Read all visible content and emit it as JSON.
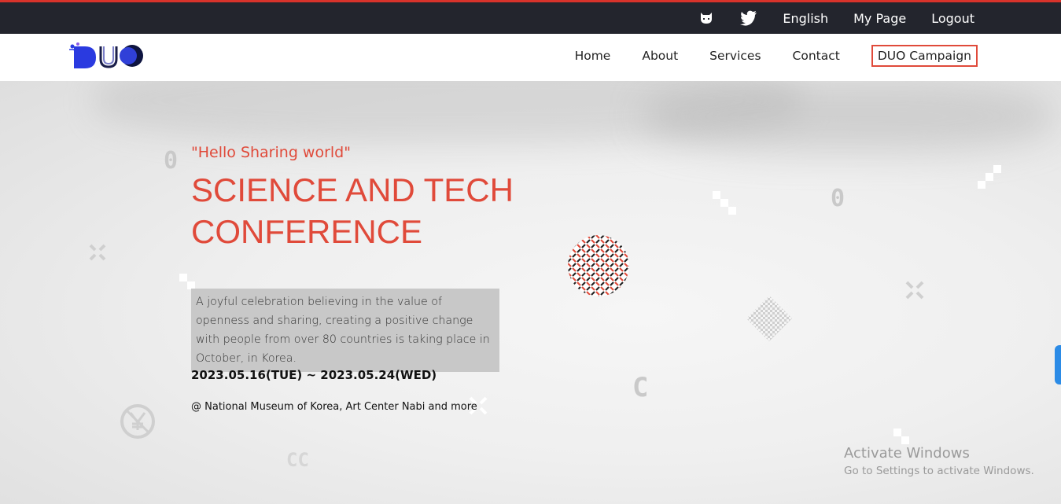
{
  "topbar": {
    "icons": [
      "github-icon",
      "twitter-icon"
    ],
    "links": {
      "language": "English",
      "my_page": "My Page",
      "logout": "Logout"
    }
  },
  "nav": {
    "logo_text": "DUO",
    "items": [
      {
        "label": "Home"
      },
      {
        "label": "About"
      },
      {
        "label": "Services"
      },
      {
        "label": "Contact"
      },
      {
        "label": "DUO Campaign"
      }
    ]
  },
  "hero": {
    "tagline": "\"Hello Sharing world\"",
    "title_line1": "SCIENCE AND TECH",
    "title_line2": "CONFERENCE",
    "description": "A joyful celebration believing in the value of openness and sharing, creating a positive change with people from over 80 countries is taking place in October, in Korea.",
    "dates": "2023.05.16(TUE) ~ 2023.05.24(WED)",
    "venue": "@ National Museum of Korea, Art Center Nabi and more",
    "decorations": [
      "0",
      "0",
      "C",
      "CC"
    ]
  },
  "os_overlay": {
    "title": "Activate Windows",
    "subtitle": "Go to Settings to activate Windows."
  },
  "colors": {
    "accent": "#e04a3a",
    "topbar": "#23252d",
    "sidetab": "#2b8be6"
  }
}
